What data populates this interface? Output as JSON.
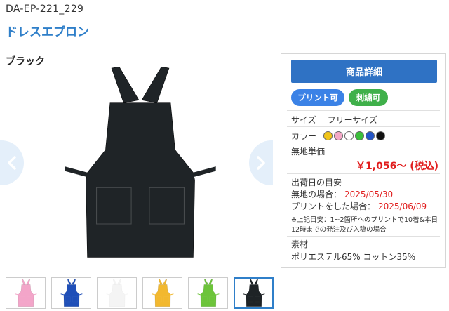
{
  "product": {
    "code": "DA-EP-221_229",
    "name": "ドレスエプロン",
    "color_title": "ブラック"
  },
  "panel": {
    "detail_button": "商品詳細",
    "badge_print": "プリント可",
    "badge_embroidery": "刺繍可",
    "size_label": "サイズ",
    "size_value": "フリーサイズ",
    "color_label": "カラー",
    "swatches": [
      "#f0c419",
      "#f4a9c7",
      "#ffffff",
      "#3bbf3b",
      "#2456c8",
      "#111111"
    ],
    "price_label": "無地単価",
    "price": "￥1,056～ (税込)",
    "ship_title": "出荷日の目安",
    "ship_plain_label": "無地の場合：",
    "ship_plain_date": "2025/05/30",
    "ship_print_label": "プリントをした場合：",
    "ship_print_date": "2025/06/09",
    "note": "※上記目安：1~2箇所へのプリントで10着&本日12時までの発注及び入稿の場合",
    "material_label": "素材",
    "material_value": "ポリエステル65% コットン35%"
  },
  "thumbnails": [
    {
      "color_name": "pink",
      "color": "#f3a5c9"
    },
    {
      "color_name": "blue",
      "color": "#1f4fb8"
    },
    {
      "color_name": "white",
      "color": "#f4f4f4"
    },
    {
      "color_name": "yellow",
      "color": "#f2b82e"
    },
    {
      "color_name": "green",
      "color": "#6cc43a"
    },
    {
      "color_name": "black",
      "color": "#1e2326"
    }
  ],
  "main_image_color": "#1f2427",
  "accent_color": "#2f72c4"
}
